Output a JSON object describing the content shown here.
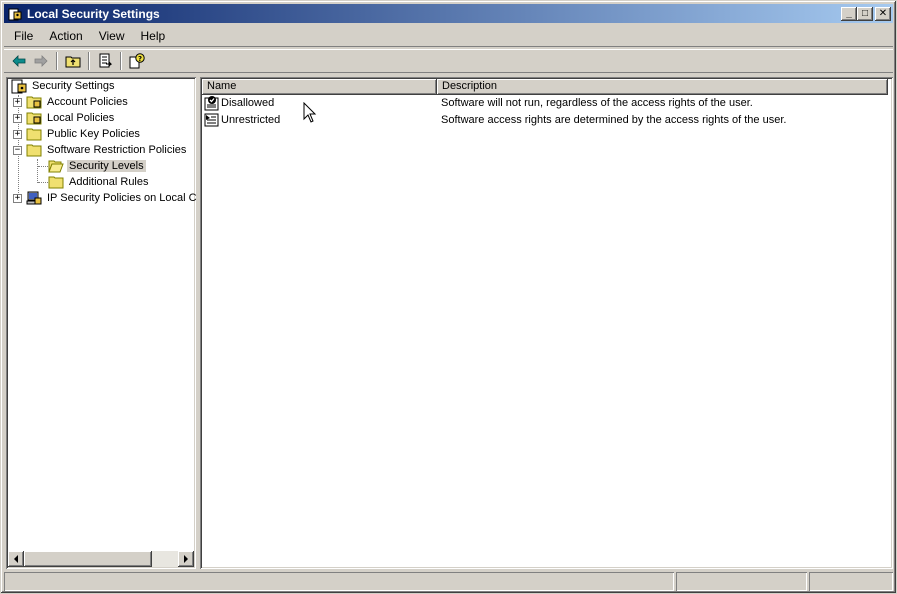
{
  "window": {
    "title": "Local Security Settings",
    "minimize_glyph": "_",
    "maximize_glyph": "□",
    "close_glyph": "✕"
  },
  "menu": [
    "File",
    "Action",
    "View",
    "Help"
  ],
  "toolbar": [
    "back-icon",
    "forward-icon",
    "up-folder-icon",
    "export-list-icon",
    "help-icon"
  ],
  "tree": {
    "root": "Security Settings",
    "items": [
      {
        "label": "Account Policies",
        "expander": "+"
      },
      {
        "label": "Local Policies",
        "expander": "+"
      },
      {
        "label": "Public Key Policies",
        "expander": "+"
      },
      {
        "label": "Software Restriction Policies",
        "expander": "−"
      },
      {
        "label": "Security Levels",
        "selected": true
      },
      {
        "label": "Additional Rules"
      },
      {
        "label": "IP Security Policies on Local Computer",
        "expander": "+"
      }
    ]
  },
  "list": {
    "columns": [
      "Name",
      "Description"
    ],
    "rows": [
      {
        "name": "Disallowed",
        "description": "Software will not run, regardless of the access rights of the user.",
        "icon": "disallowed-icon"
      },
      {
        "name": "Unrestricted",
        "description": "Software access rights are determined by the access rights of the user.",
        "icon": "unrestricted-icon"
      }
    ]
  },
  "colors": {
    "titlebar_start": "#0a246a",
    "titlebar_end": "#a6caf0",
    "face": "#d4d0c8"
  }
}
